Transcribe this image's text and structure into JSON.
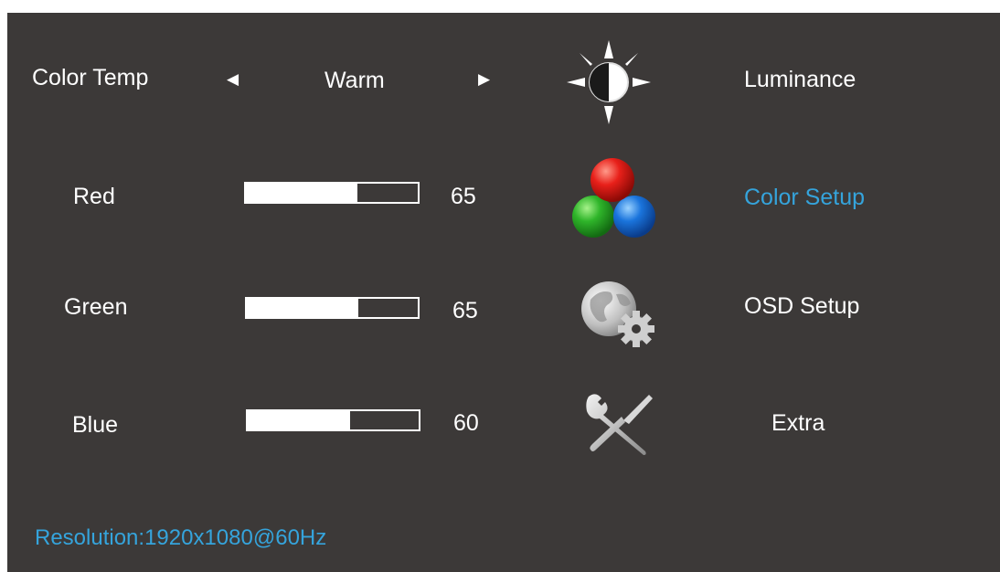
{
  "colors": {
    "background": "#3c3938",
    "text": "#ffffff",
    "accent": "#35a4dc"
  },
  "settings": {
    "color_temp": {
      "label": "Color Temp",
      "value": "Warm",
      "prev_icon": "left-arrow-icon",
      "next_icon": "right-arrow-icon"
    },
    "red": {
      "label": "Red",
      "value": "65",
      "level": 0.65
    },
    "green": {
      "label": "Green",
      "value": "65",
      "level": 0.65
    },
    "blue": {
      "label": "Blue",
      "value": "60",
      "level": 0.6
    }
  },
  "menu": [
    {
      "label": "Luminance",
      "icon": "brightness-icon",
      "selected": false
    },
    {
      "label": "Color Setup",
      "icon": "color-setup-icon",
      "selected": true
    },
    {
      "label": "OSD Setup",
      "icon": "osd-setup-icon",
      "selected": false
    },
    {
      "label": "Extra",
      "icon": "extra-tools-icon",
      "selected": false
    }
  ],
  "status": {
    "resolution": "Resolution:1920x1080@60Hz"
  }
}
